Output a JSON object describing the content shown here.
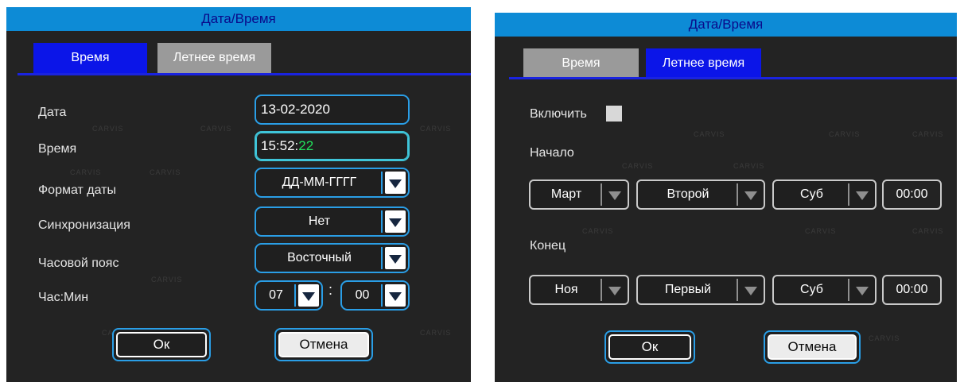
{
  "datetime_screen": {
    "title": "Дата/Время",
    "tabs": [
      {
        "label": "Время",
        "active": true
      },
      {
        "label": "Летнее время",
        "active": false
      }
    ],
    "rows": {
      "date_label": "Дата",
      "date_value": "13-02-2020",
      "time_label": "Время",
      "time_value_hm": "15:52:",
      "time_value_sec": "22",
      "format_label": "Формат даты",
      "format_value": "ДД-ММ-ГГГГ",
      "sync_label": "Синхронизация",
      "sync_value": "Нет",
      "tz_label": "Часовой пояс",
      "tz_value": "Восточный",
      "hourmin_label": "Час:Мин",
      "hour_value": "07",
      "colon": ":",
      "min_value": "00"
    },
    "ok_label": "Ок",
    "cancel_label": "Отмена"
  },
  "dst_screen": {
    "title": "Дата/Время",
    "tabs": [
      {
        "label": "Время",
        "active": false
      },
      {
        "label": "Летнее время",
        "active": true
      }
    ],
    "enable_label": "Включить",
    "enable_checked": false,
    "start_label": "Начало",
    "start": {
      "month": "Март",
      "week": "Второй",
      "day": "Суб",
      "time": "00:00"
    },
    "end_label": "Конец",
    "end": {
      "month": "Ноя",
      "week": "Первый",
      "day": "Суб",
      "time": "00:00"
    },
    "ok_label": "Ок",
    "cancel_label": "Отмена"
  },
  "watermark": {
    "text": "CARVIS"
  },
  "colors": {
    "title_bar": "#0d8bd6",
    "active_tab": "#0b15e8",
    "inactive_tab": "#9a9a9a",
    "field_border": "#2a9ee6",
    "seconds_text": "#22e05c",
    "panel_bg": "#232323"
  }
}
